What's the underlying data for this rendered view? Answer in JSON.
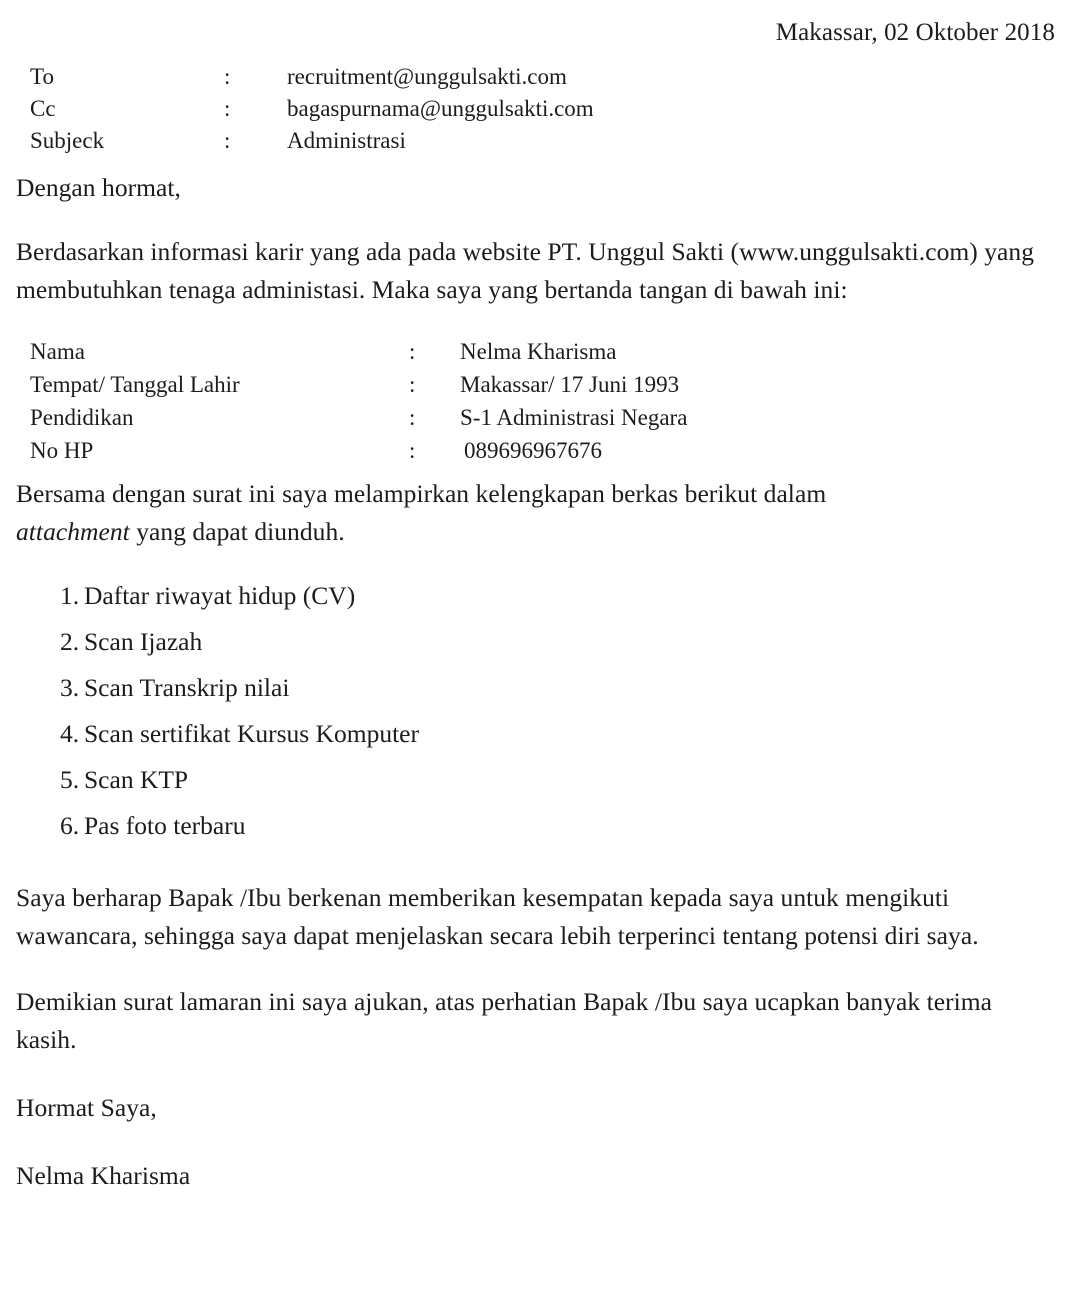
{
  "document": {
    "date_line": "Makassar, 02 Oktober 2018",
    "header_fields": [
      {
        "label": "To",
        "separator": ":",
        "value": "recruitment@unggulsakti.com"
      },
      {
        "label": "Cc",
        "separator": ":",
        "value": "bagaspurnama@unggulsakti.com"
      },
      {
        "label": "Subjeck",
        "separator": ":",
        "value": "Administrasi"
      }
    ],
    "greeting": "Dengan hormat,",
    "intro_paragraph": "Berdasarkan informasi karir yang ada pada website PT. Unggul Sakti (www.unggulsakti.com) yang membutuhkan tenaga administasi. Maka saya yang bertanda tangan di bawah ini:",
    "personal_details": [
      {
        "label": "Nama",
        "separator": ":",
        "value": "Nelma Kharisma"
      },
      {
        "label": "Tempat/ Tanggal Lahir",
        "separator": ":",
        "value": "Makassar/ 17 Juni 1993"
      },
      {
        "label": "Pendidikan",
        "separator": ":",
        "value": "S-1 Administrasi Negara"
      },
      {
        "label": "No HP",
        "separator": ":",
        "value": "089696967676"
      }
    ],
    "attachment_intro": {
      "before_italic": "Bersama dengan surat ini saya melampirkan kelengkapan berkas berikut dalam ",
      "italic": "attachment",
      "after_italic": " yang dapat diunduh."
    },
    "attachment_list": [
      {
        "number": "1.",
        "text": "Daftar riwayat hidup (CV)"
      },
      {
        "number": "2.",
        "text": "Scan Ijazah"
      },
      {
        "number": "3.",
        "text": "Scan Transkrip nilai"
      },
      {
        "number": "4.",
        "text": "Scan sertifikat Kursus Komputer"
      },
      {
        "number": "5.",
        "text": "Scan KTP"
      },
      {
        "number": "6.",
        "text": "Pas foto terbaru"
      }
    ],
    "hope_paragraph": "Saya berharap Bapak /Ibu berkenan memberikan kesempatan kepada saya untuk mengikuti wawancara, sehingga saya dapat menjelaskan secara lebih terperinci tentang potensi diri saya.",
    "closing_paragraph": "Demikian surat lamaran ini saya ajukan, atas perhatian Bapak /Ibu saya ucapkan banyak terima kasih.",
    "regards": "Hormat Saya,",
    "signature_name": "Nelma Kharisma"
  },
  "colors": {
    "page_background": "#ffffff",
    "text": "#1c1c20"
  }
}
